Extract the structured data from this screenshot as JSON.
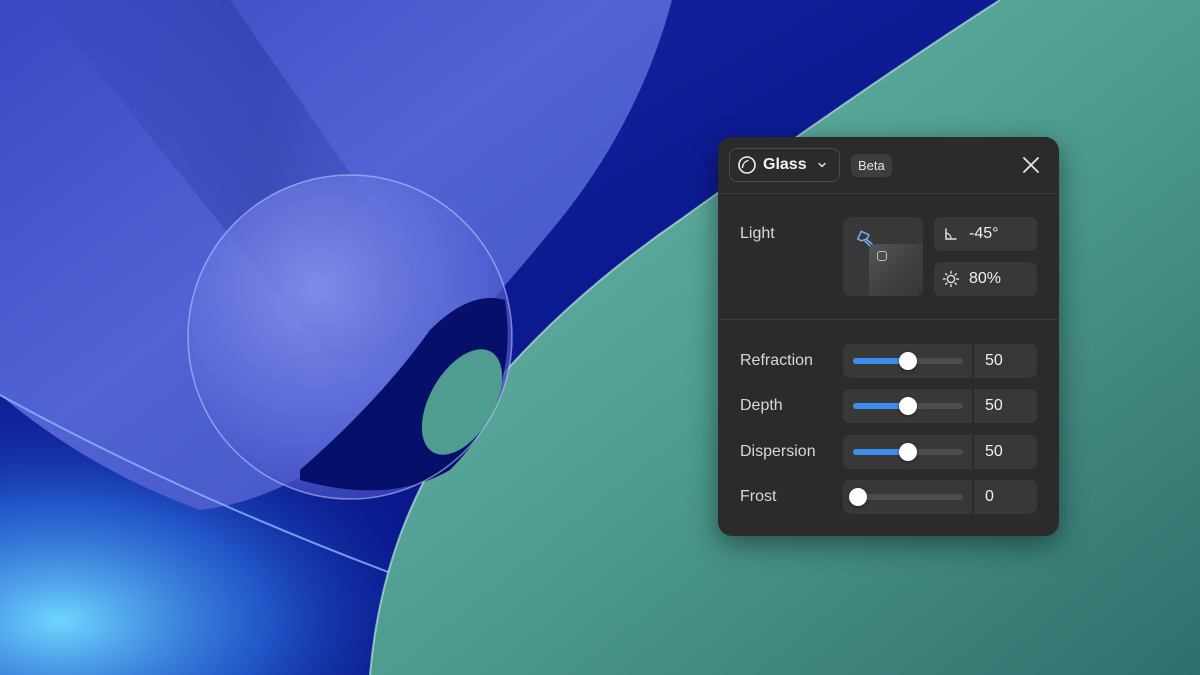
{
  "panel": {
    "effect_name": "Glass",
    "effect_icon": "glass-circle-icon",
    "badge": "Beta",
    "light": {
      "label": "Light",
      "angle": "-45°",
      "intensity": "80%"
    },
    "sliders": [
      {
        "label": "Refraction",
        "value": "50",
        "fraction": 0.5
      },
      {
        "label": "Depth",
        "value": "50",
        "fraction": 0.5
      },
      {
        "label": "Dispersion",
        "value": "50",
        "fraction": 0.5
      },
      {
        "label": "Frost",
        "value": "0",
        "fraction": 0.0
      }
    ]
  },
  "colors": {
    "panel_bg": "#2b2b2b",
    "accent": "#3d8df0",
    "teal": "#5fa89a",
    "indigo": "#4e58c8"
  }
}
